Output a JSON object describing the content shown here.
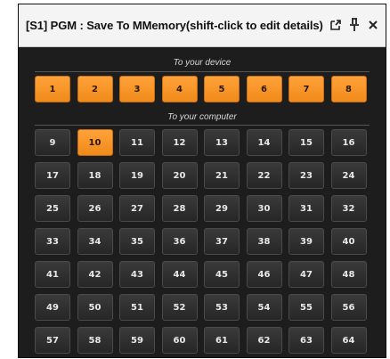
{
  "window": {
    "title": "[S1] PGM : Save To MMemory(shift-click to edit details)"
  },
  "title_icons": [
    {
      "name": "popout-icon"
    },
    {
      "name": "pin-icon"
    },
    {
      "name": "close-icon"
    }
  ],
  "device_section": {
    "label": "To your device",
    "slots": [
      "1",
      "2",
      "3",
      "4",
      "5",
      "6",
      "7",
      "8"
    ]
  },
  "computer_section": {
    "label": "To your computer",
    "selected": "10",
    "slots": [
      "9",
      "10",
      "11",
      "12",
      "13",
      "14",
      "15",
      "16",
      "17",
      "18",
      "19",
      "20",
      "21",
      "22",
      "23",
      "24",
      "25",
      "26",
      "27",
      "28",
      "29",
      "30",
      "31",
      "32",
      "33",
      "34",
      "35",
      "36",
      "37",
      "38",
      "39",
      "40",
      "41",
      "42",
      "43",
      "44",
      "45",
      "46",
      "47",
      "48",
      "49",
      "50",
      "51",
      "52",
      "53",
      "54",
      "55",
      "56",
      "57",
      "58",
      "59",
      "60",
      "61",
      "62",
      "63",
      "64"
    ]
  },
  "colors": {
    "accent": "#f5961f",
    "panel": "#1d1d1d",
    "button": "#2f2f2f"
  }
}
